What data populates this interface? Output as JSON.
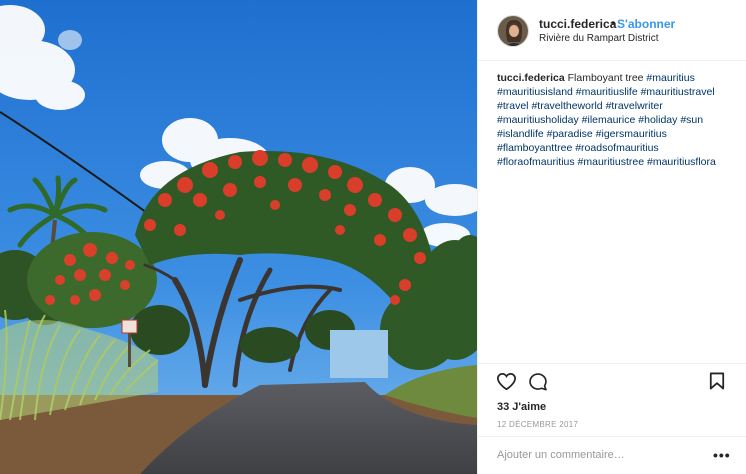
{
  "post": {
    "image_alt": "Flamboyant tree over a road in Mauritius"
  },
  "header": {
    "username": "tucci.federica",
    "separator": "•",
    "follow_label": "S'abonner",
    "location": "Rivière du Rampart District"
  },
  "caption": {
    "username": "tucci.federica",
    "text": "Flamboyant tree",
    "hashtags": [
      "#mauritius",
      "#mauritiusisland",
      "#mauritiuslife",
      "#mauritiustravel",
      "#travel",
      "#traveltheworld",
      "#travelwriter",
      "#mauritiusholiday",
      "#ilemaurice",
      "#holiday",
      "#sun",
      "#islandlife",
      "#paradise",
      "#igersmauritius",
      "#flamboyanttree",
      "#roadsofmauritius",
      "#floraofmauritius",
      "#mauritiustree",
      "#mauritiusflora"
    ]
  },
  "actions": {
    "like_icon": "heart-icon",
    "comment_icon": "comment-icon",
    "save_icon": "bookmark-icon",
    "likes_label": "33 J'aime",
    "date": "12 DÉCEMBRE 2017"
  },
  "comment": {
    "placeholder": "Ajouter un commentaire…",
    "more_label": "•••"
  },
  "colors": {
    "link_blue": "#3897f0",
    "hashtag": "#003569",
    "sky": "#2b7fd6",
    "flower": "#d9402b"
  }
}
